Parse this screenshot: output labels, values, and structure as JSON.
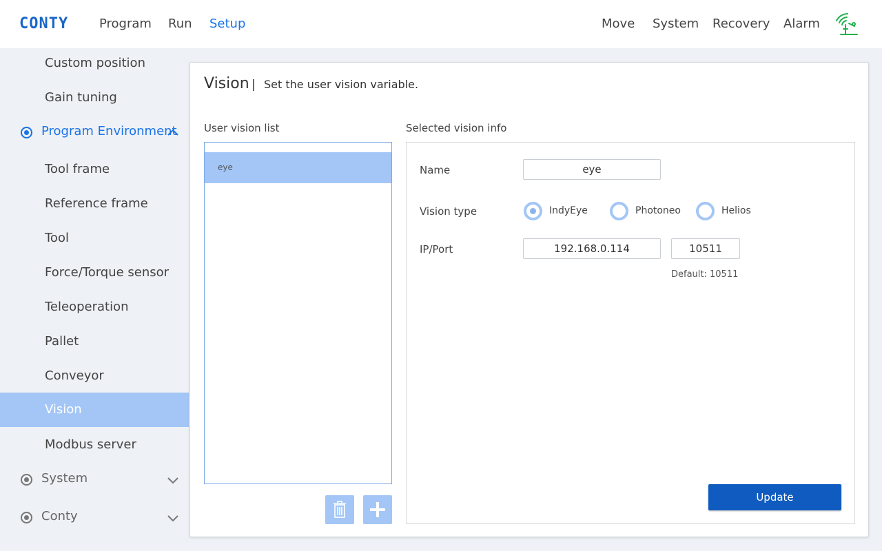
{
  "header": {
    "logo": "CONTY",
    "nav_left": [
      "Program",
      "Run",
      "Setup"
    ],
    "active": "Setup",
    "nav_right": [
      "Move",
      "System",
      "Recovery",
      "Alarm"
    ],
    "status_icon": "wifi-signal-icon",
    "accent_color": "#1a73e8"
  },
  "sidebar": {
    "items_top": [
      "Custom position",
      "Gain tuning"
    ],
    "group_open": "Program Environment",
    "sub_items": [
      "Tool frame",
      "Reference frame",
      "Tool",
      "Force/Torque sensor",
      "Teleoperation",
      "Pallet",
      "Conveyor",
      "Vision",
      "Modbus server"
    ],
    "selected": "Vision",
    "groups_closed": [
      "System",
      "Conty"
    ]
  },
  "card": {
    "title": "Vision",
    "separator": "|",
    "description": "Set the user vision variable.",
    "list_label": "User vision list",
    "info_label": "Selected vision info",
    "list_items": [
      "eye"
    ]
  },
  "info": {
    "name_label": "Name",
    "name_value": "eye",
    "type_label": "Vision type",
    "types": [
      "IndyEye",
      "Photoneo",
      "Helios"
    ],
    "selected_type": "IndyEye",
    "ip_label": "IP/Port",
    "ip_value": "192.168.0.114",
    "port_value": "10511",
    "port_default": "Default: 10511",
    "update_label": "Update"
  }
}
